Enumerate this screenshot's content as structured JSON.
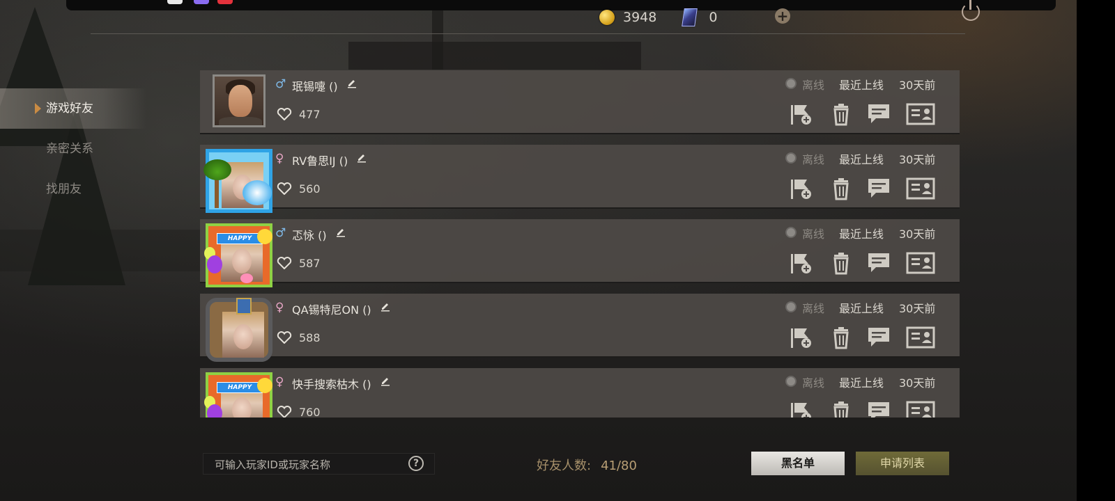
{
  "currency": {
    "coins": "3948",
    "cards": "0"
  },
  "nav": {
    "items": [
      {
        "label": "游戏好友",
        "active": true
      },
      {
        "label": "亲密关系",
        "active": false
      },
      {
        "label": "找朋友",
        "active": false
      }
    ]
  },
  "friends": [
    {
      "gender": "♂",
      "name": "珉锡嚏 ()",
      "likes": "477",
      "status": "离线",
      "last_online_label": "最近上线",
      "last_online": "30天前",
      "avatar": "male-portrait"
    },
    {
      "gender": "♀",
      "name": "RV鲁思IJ ()",
      "likes": "560",
      "status": "离线",
      "last_online_label": "最近上线",
      "last_online": "30天前",
      "avatar": "tropical-frame"
    },
    {
      "gender": "♂",
      "name": "忑怺 ()",
      "likes": "587",
      "status": "离线",
      "last_online_label": "最近上线",
      "last_online": "30天前",
      "avatar": "happy-frame"
    },
    {
      "gender": "♀",
      "name": "QA锡特尼ON ()",
      "likes": "588",
      "status": "离线",
      "last_online_label": "最近上线",
      "last_online": "30天前",
      "avatar": "knight-frame"
    },
    {
      "gender": "♀",
      "name": "快手搜索枯木 ()",
      "likes": "760",
      "status": "离线",
      "last_online_label": "最近上线",
      "last_online": "30天前",
      "avatar": "happy-frame"
    }
  ],
  "search": {
    "placeholder": "可输入玩家ID或玩家名称",
    "help_glyph": "?"
  },
  "friend_count": {
    "label": "好友人数:",
    "value": "41/80"
  },
  "buttons": {
    "blacklist": "黑名单",
    "requests": "申请列表"
  },
  "colors": {
    "accent_arrow": "#c98b43",
    "requests_button": "#6f6a38",
    "row_background": "#4e4a47",
    "male": "#7fb8e6",
    "female": "#e7a6c5"
  }
}
